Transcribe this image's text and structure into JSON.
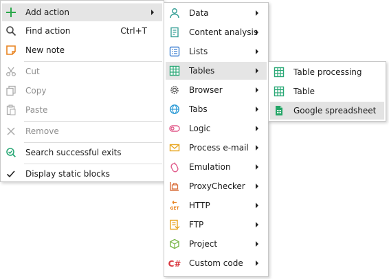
{
  "main_menu": {
    "add_action": "Add action",
    "find_action": "Find action",
    "find_shortcut": "Ctrl+T",
    "new_note": "New note",
    "cut": "Cut",
    "copy": "Copy",
    "paste": "Paste",
    "remove": "Remove",
    "search_exits": "Search successful exits",
    "display_static": "Display static blocks"
  },
  "action_menu": {
    "data": "Data",
    "content_analysis": "Content analysis",
    "lists": "Lists",
    "tables": "Tables",
    "browser": "Browser",
    "tabs": "Tabs",
    "logic": "Logic",
    "process_email": "Process e-mail",
    "emulation": "Emulation",
    "proxychecker": "ProxyChecker",
    "http": "HTTP",
    "ftp": "FTP",
    "project": "Project",
    "custom_code": "Custom code",
    "http_icon_text": "GET",
    "csharp_icon_text": "C#"
  },
  "tables_menu": {
    "table_processing": "Table processing",
    "table": "Table",
    "google_spreadsheet": "Google spreadsheet"
  },
  "colors": {
    "green": "#2aa876",
    "teal": "#3aa198",
    "orange": "#e8821e",
    "pink": "#e05a8a",
    "blue": "#3b7fd1",
    "red": "#d9363e",
    "highlight": "#e5e5e5"
  }
}
